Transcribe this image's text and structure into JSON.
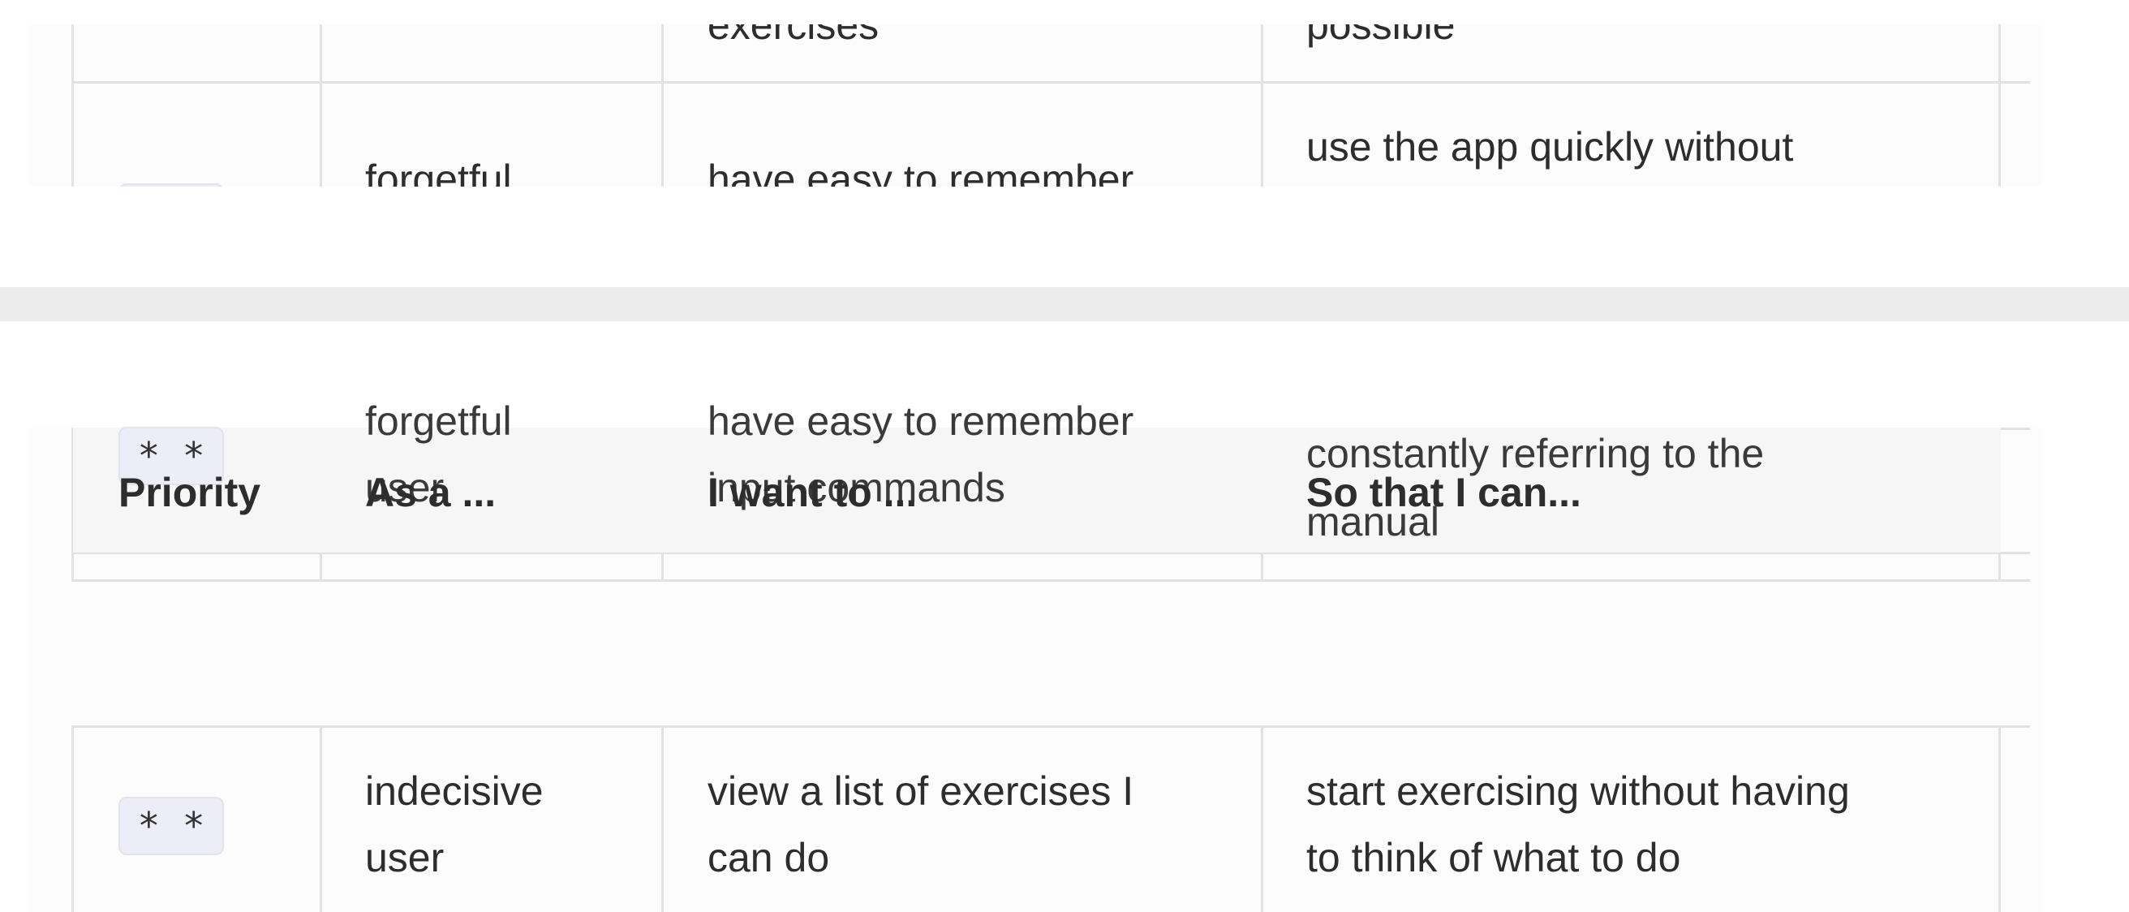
{
  "top_fragment": {
    "row_prev": {
      "want_tail": "exercises",
      "so_tail": "possible"
    },
    "row_forgetful": {
      "as_a": "forgetful",
      "want": "have easy to remember",
      "so": "use the app quickly without"
    }
  },
  "table": {
    "headers": {
      "priority": "Priority",
      "as_a": "As a ...",
      "i_want": "I want to ...",
      "so_that": "So that I can..."
    },
    "rows": [
      {
        "priority": "* *",
        "as_a_l1": "forgetful",
        "as_a_l2": "user",
        "want_l1": "have easy to remember",
        "want_l2": "input commands",
        "so_l1": "constantly referring to the",
        "so_l2": "manual"
      },
      {
        "priority": "* *",
        "as_a_l1": "indecisive",
        "as_a_l2": "user",
        "want_l1": "view a list of exercises I",
        "want_l2": "can do",
        "so_l1": "start exercising without having",
        "so_l2": "to think of what to do"
      }
    ]
  },
  "colors": {
    "border": "#e2e2e2",
    "chip_bg": "#ededf8",
    "divider": "#ececec",
    "panel_bg": "#fcfcfc"
  }
}
